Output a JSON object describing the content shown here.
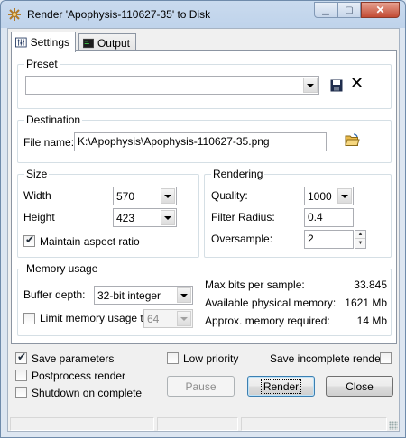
{
  "window": {
    "title": "Render 'Apophysis-110627-35' to Disk"
  },
  "tabs": [
    {
      "label": "Settings"
    },
    {
      "label": "Output"
    }
  ],
  "preset": {
    "legend": "Preset",
    "value": ""
  },
  "destination": {
    "legend": "Destination",
    "file_label": "File name:",
    "file_value": "K:\\Apophysis\\Apophysis-110627-35.png"
  },
  "size": {
    "legend": "Size",
    "width_label": "Width",
    "width_value": "570",
    "height_label": "Height",
    "height_value": "423",
    "aspect_label": "Maintain aspect ratio",
    "aspect_checked": true
  },
  "rendering": {
    "legend": "Rendering",
    "quality_label": "Quality:",
    "quality_value": "1000",
    "filter_label": "Filter Radius:",
    "filter_value": "0.4",
    "oversample_label": "Oversample:",
    "oversample_value": "2"
  },
  "memory": {
    "legend": "Memory usage",
    "buffer_label": "Buffer depth:",
    "buffer_value": "32-bit integer",
    "limit_label": "Limit memory usage to:",
    "limit_value": "64",
    "limit_checked": false,
    "max_bits_label": "Max bits per sample:",
    "max_bits_value": "33.845",
    "avail_label": "Available physical memory:",
    "avail_value": "1621 Mb",
    "required_label": "Approx. memory required:",
    "required_value": "14 Mb"
  },
  "options": {
    "save_params": "Save parameters",
    "save_params_checked": true,
    "postprocess": "Postprocess render",
    "postprocess_checked": false,
    "shutdown": "Shutdown on complete",
    "shutdown_checked": false,
    "low_priority": "Low priority",
    "low_priority_checked": false,
    "save_incomplete": "Save incomplete renders",
    "save_incomplete_checked": false
  },
  "buttons": {
    "pause": "Pause",
    "render": "Render",
    "close": "Close"
  },
  "colors": {
    "title_bg": "#c9daee",
    "close_button": "#c24b34"
  }
}
